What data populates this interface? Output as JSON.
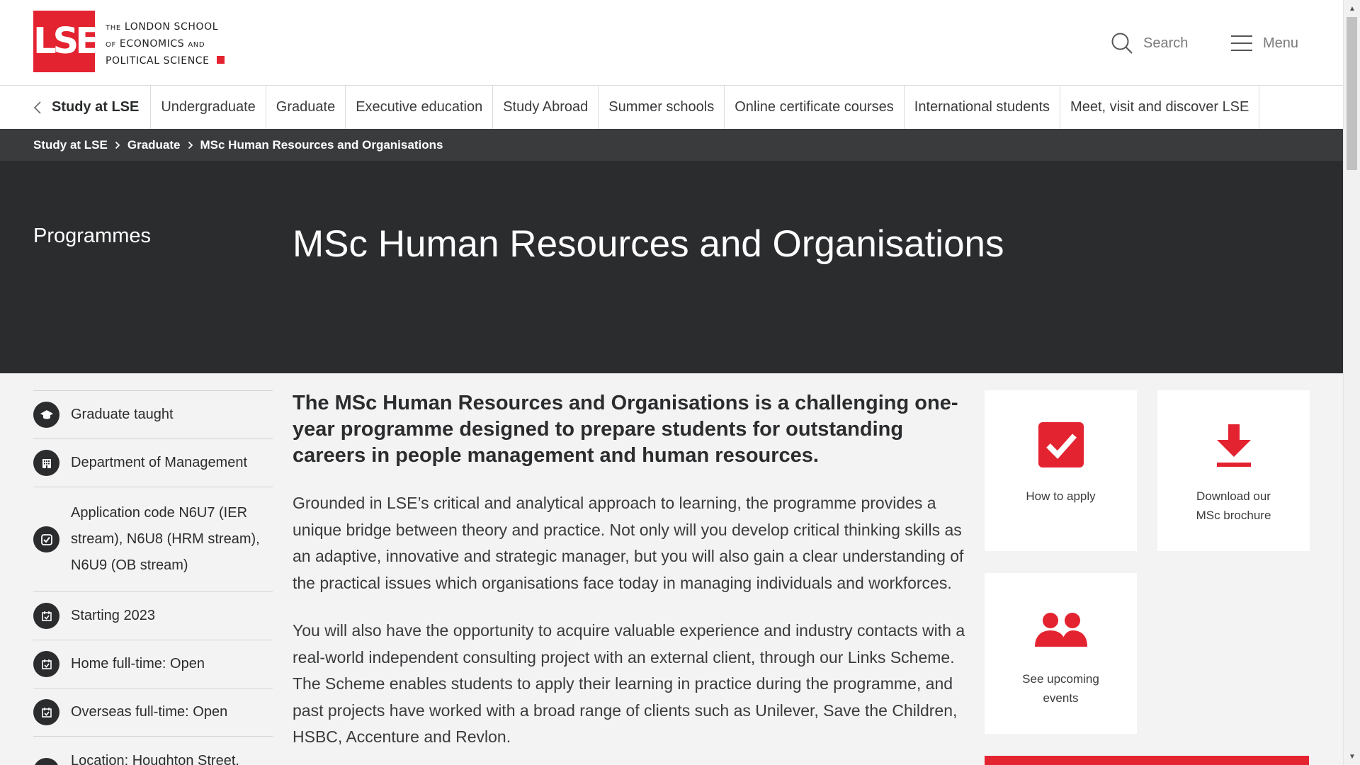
{
  "brand": {
    "logo_mark": "LSE",
    "name_line1_small": "THE",
    "name_line1": "LONDON SCHOOL",
    "name_line2_small": "OF",
    "name_line2": "ECONOMICS",
    "name_line2_small_b": "AND",
    "name_line3": "POLITICAL SCIENCE",
    "accent": "#e42330"
  },
  "header": {
    "search_label": "Search",
    "menu_label": "Menu"
  },
  "subnav": {
    "back_label": "Study at LSE",
    "items": [
      "Undergraduate",
      "Graduate",
      "Executive education",
      "Study Abroad",
      "Summer schools",
      "Online certificate courses",
      "International students",
      "Meet, visit and discover LSE"
    ]
  },
  "breadcrumb": [
    "Study at LSE",
    "Graduate",
    "MSc Human Resources and Organisations"
  ],
  "hero": {
    "section": "Programmes",
    "title": "MSc Human Resources and Organisations"
  },
  "facts": [
    {
      "icon": "graduation-cap-icon",
      "text": "Graduate taught"
    },
    {
      "icon": "building-icon",
      "text": "Department of Management"
    },
    {
      "icon": "check-circle-icon",
      "text": "Application code N6U7 (IER stream), N6U8 (HRM stream), N6U9 (OB stream)"
    },
    {
      "icon": "calendar-icon",
      "text": "Starting 2023"
    },
    {
      "icon": "calendar-icon",
      "text": "Home full-time: Open"
    },
    {
      "icon": "calendar-icon",
      "text": "Overseas full-time: Open"
    },
    {
      "icon": "location-icon",
      "text": "Location: Houghton Street,"
    }
  ],
  "main": {
    "lead": "The MSc Human Resources and Organisations is a challenging one-year programme designed to prepare students for outstanding careers in people management and human resources.",
    "para1": "Grounded in LSE’s critical and analytical approach to learning, the programme provides a unique bridge between theory and practice. Not only will you develop critical thinking skills as an adaptive, innovative and strategic manager, but you will also gain a clear understanding of the practical issues which organisations face today in managing individuals and workforces.",
    "para2": "You will also have the opportunity to acquire valuable experience and industry contacts with a real-world independent consulting project with an external client, through our Links Scheme. The Scheme enables students to apply their learning in practice during the programme, and past projects have worked with a broad range of clients such as Unilever, Save the Children, HSBC, Accenture and Revlon."
  },
  "cards": {
    "apply": "How to apply",
    "brochure_line1": "Download our",
    "brochure_line2": "MSc brochure",
    "events_line1": "See upcoming",
    "events_line2": "events"
  }
}
